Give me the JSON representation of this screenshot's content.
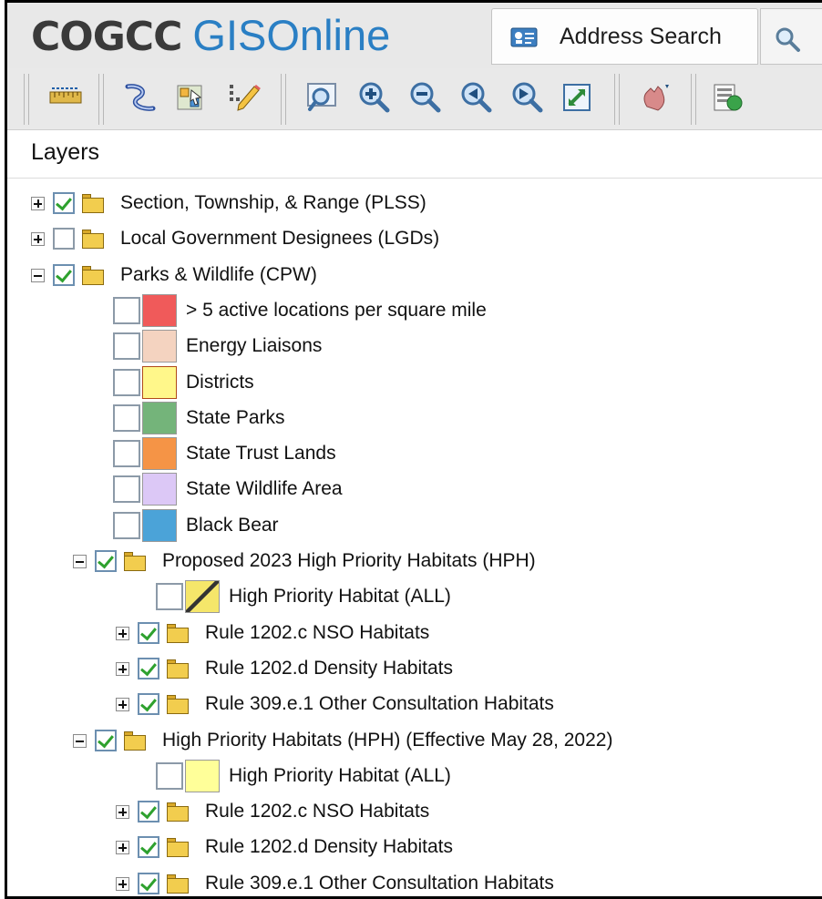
{
  "header": {
    "logo_part1": "COGCC",
    "logo_part2": "GIS",
    "logo_part3": "Online",
    "search_tab_label": "Address Search"
  },
  "toolbar": {
    "buttons": [
      {
        "icon": "ruler-icon"
      },
      {
        "icon": "identify-polyline-icon"
      },
      {
        "icon": "select-features-icon"
      },
      {
        "icon": "edit-pencil-icon"
      },
      {
        "icon": "zoom-box-icon"
      },
      {
        "icon": "zoom-in-icon"
      },
      {
        "icon": "zoom-out-icon"
      },
      {
        "icon": "zoom-previous-icon"
      },
      {
        "icon": "zoom-next-icon"
      },
      {
        "icon": "full-extent-icon"
      },
      {
        "icon": "pan-hand-icon"
      },
      {
        "icon": "map-layers-icon"
      }
    ]
  },
  "layers": {
    "title": "Layers",
    "items": [
      {
        "label": "Section, Township, & Range (PLSS)",
        "type": "group",
        "expanded": false,
        "checked": true
      },
      {
        "label": "Local Government Designees (LGDs)",
        "type": "group",
        "expanded": false,
        "checked": false
      },
      {
        "label": "Parks & Wildlife (CPW)",
        "type": "group",
        "expanded": true,
        "checked": true
      },
      {
        "label": "> 5 active locations per square mile",
        "type": "layer",
        "checked": false,
        "color": "#f05a5a"
      },
      {
        "label": "Energy Liaisons",
        "type": "layer",
        "checked": false,
        "color": "#f4d3c0"
      },
      {
        "label": "Districts",
        "type": "layer",
        "checked": false,
        "color": "#fff78a"
      },
      {
        "label": "State Parks",
        "type": "layer",
        "checked": false,
        "color": "#74b47a"
      },
      {
        "label": "State Trust Lands",
        "type": "layer",
        "checked": false,
        "color": "#f59446"
      },
      {
        "label": "State Wildlife Area",
        "type": "layer",
        "checked": false,
        "color": "#dcc8f6"
      },
      {
        "label": "Black Bear",
        "type": "layer",
        "checked": false,
        "color": "#4ba3d8"
      },
      {
        "label": "Proposed 2023 High Priority Habitats (HPH)",
        "type": "group",
        "expanded": true,
        "checked": true
      },
      {
        "label": "High Priority Habitat (ALL)",
        "type": "layer",
        "checked": false,
        "color": "#f5e66a",
        "hatched": true
      },
      {
        "label": "Rule 1202.c NSO Habitats",
        "type": "group",
        "expanded": false,
        "checked": true
      },
      {
        "label": "Rule 1202.d Density Habitats",
        "type": "group",
        "expanded": false,
        "checked": true
      },
      {
        "label": "Rule 309.e.1 Other Consultation Habitats",
        "type": "group",
        "expanded": false,
        "checked": true
      },
      {
        "label": "High Priority Habitats (HPH) (Effective May 28, 2022)",
        "type": "group",
        "expanded": true,
        "checked": true
      },
      {
        "label": "High Priority Habitat (ALL)",
        "type": "layer",
        "checked": false,
        "color": "#ffff99"
      },
      {
        "label": "Rule 1202.c NSO Habitats",
        "type": "group",
        "expanded": false,
        "checked": true
      },
      {
        "label": "Rule 1202.d Density Habitats",
        "type": "group",
        "expanded": false,
        "checked": true
      },
      {
        "label": "Rule 309.e.1 Other Consultation Habitats",
        "type": "group",
        "expanded": false,
        "checked": true
      }
    ]
  }
}
